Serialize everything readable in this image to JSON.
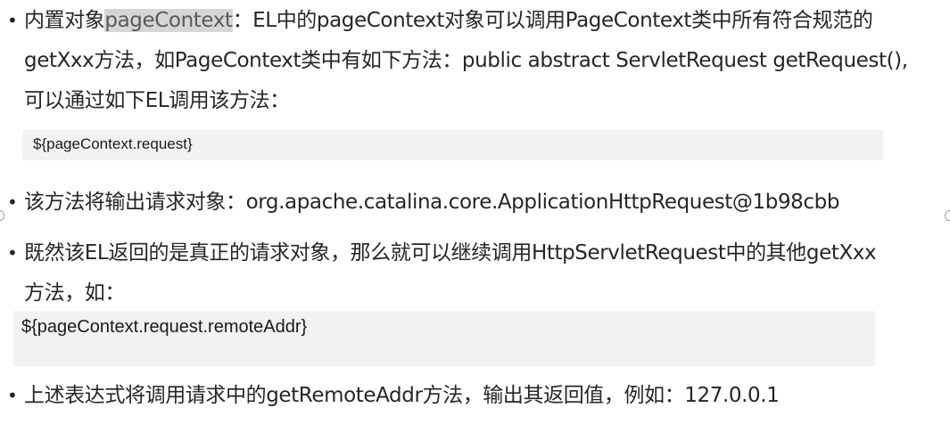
{
  "bullets": [
    {
      "highlight": "pageContext",
      "lines": [
        "内置对象",
        "：EL中的pageContext对象可以调用PageContext类中所有符合规范的",
        "getXxx方法，如PageContext类中有如下方法：public abstract ServletRequest getRequest(),",
        "可以通过如下EL调用该方法："
      ]
    },
    {
      "lines": [
        "该方法将输出请求对象：org.apache.catalina.core.ApplicationHttpRequest@1b98cbb"
      ]
    },
    {
      "lines": [
        "既然该EL返回的是真正的请求对象，那么就可以继续调用HttpServletRequest中的其他getXxx",
        "方法，如："
      ]
    },
    {
      "lines": [
        "上述表达式将调用请求中的getRemoteAddr方法，输出其返回值，例如：127.0.0.1"
      ]
    }
  ],
  "code_blocks": [
    "${pageContext.request}",
    "${pageContext.request.remoteAddr}"
  ],
  "bullet_glyph": "•"
}
